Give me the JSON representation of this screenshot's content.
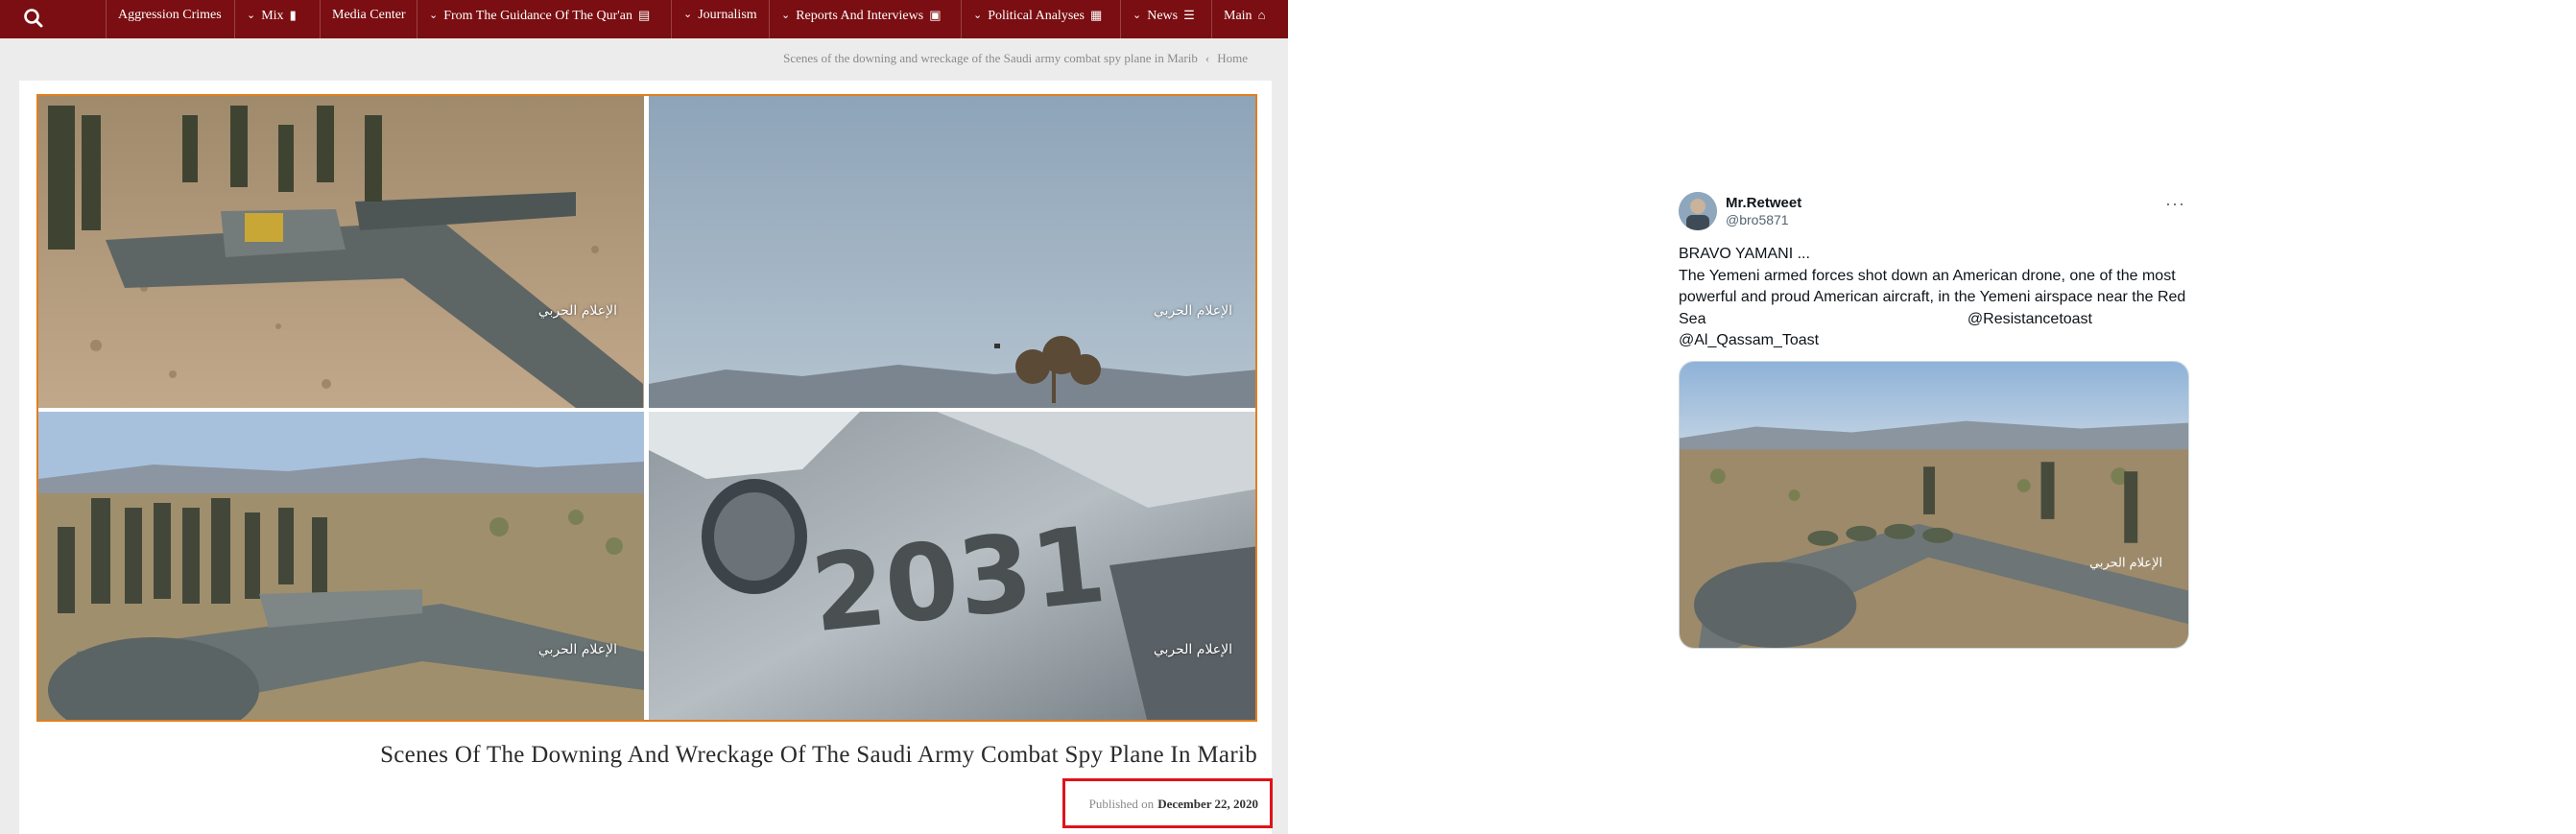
{
  "site": {
    "nav": {
      "search_icon": "search-icon",
      "items": [
        {
          "label": "Aggression Crimes",
          "has_dropdown": false,
          "icon": ""
        },
        {
          "label": "Mix",
          "has_dropdown": true,
          "icon": "mobile-icon"
        },
        {
          "label": "Media Center",
          "has_dropdown": false,
          "icon": ""
        },
        {
          "label": "From The Guidance Of The Qur'an",
          "has_dropdown": true,
          "icon": "book-icon"
        },
        {
          "label": "Journalism",
          "has_dropdown": true,
          "icon": ""
        },
        {
          "label": "Reports And Interviews",
          "has_dropdown": true,
          "icon": "card-icon"
        },
        {
          "label": "Political Analyses",
          "has_dropdown": true,
          "icon": "map-icon"
        },
        {
          "label": "News",
          "has_dropdown": true,
          "icon": "list-icon"
        },
        {
          "label": "Main",
          "has_dropdown": false,
          "icon": "home-icon"
        }
      ]
    },
    "breadcrumb": {
      "current": "Scenes of the downing and wreckage of the Saudi army combat spy plane in Marib",
      "separator": "‹",
      "home": "Home"
    },
    "article": {
      "watermark": "الإعلام الحربي",
      "title": "Scenes Of The Downing And Wreckage Of The Saudi Army Combat Spy Plane In Marib",
      "published_label": "Published on",
      "published_date": "December 22, 2020",
      "tail_number": "2031"
    },
    "colors": {
      "nav_bg": "#7a0e12",
      "mosaic_border": "#e07f1f",
      "highlight_box": "#e0121a"
    }
  },
  "tweet": {
    "display_name": "Mr.Retweet",
    "handle": "@bro5871",
    "more_icon": "more-icon",
    "lines": [
      "BRAVO YAMANI ...",
      "The Yemeni armed forces shot down an American drone, one of the most powerful and proud American aircraft, in the Yemeni airspace near the Red Sea"
    ],
    "mentions": [
      "@Resistancetoast",
      "@Al_Qassam_Toast"
    ],
    "media_watermark": "الإعلام الحربي"
  }
}
